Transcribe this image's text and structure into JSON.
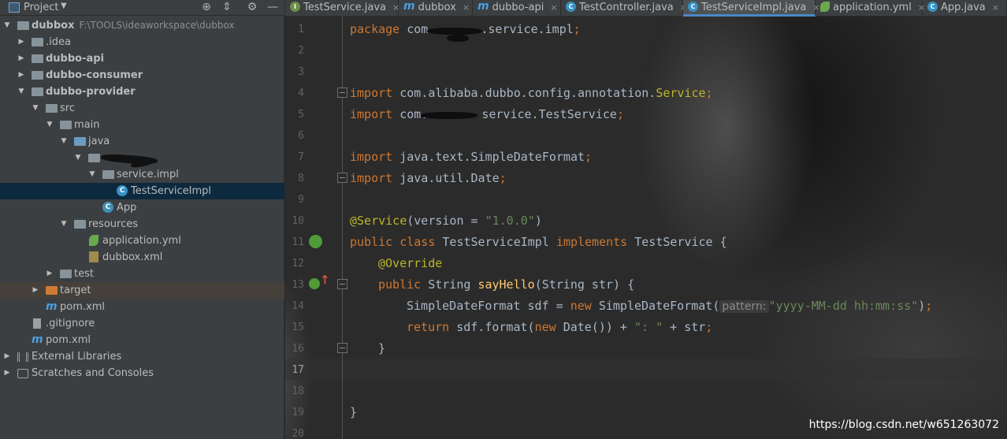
{
  "project_panel": {
    "title": "Project",
    "header_icons": [
      "target-icon",
      "collapse-icon",
      "gear-icon",
      "hide-icon"
    ],
    "tree": [
      {
        "label": "dubbox",
        "path": "F:\\TOOLS\\ideaworkspace\\dubbox",
        "icon": "module-folder-icon",
        "expanded": true
      },
      {
        "label": ".idea",
        "icon": "folder-icon",
        "expanded": false
      },
      {
        "label": "dubbo-api",
        "icon": "module-folder-icon",
        "expanded": false
      },
      {
        "label": "dubbo-consumer",
        "icon": "module-folder-icon",
        "expanded": false
      },
      {
        "label": "dubbo-provider",
        "icon": "module-folder-icon",
        "expanded": true
      },
      {
        "label": "src",
        "icon": "folder-icon",
        "expanded": true
      },
      {
        "label": "main",
        "icon": "folder-icon",
        "expanded": true
      },
      {
        "label": "java",
        "icon": "source-folder-icon",
        "expanded": true
      },
      {
        "label": "",
        "icon": "package-icon",
        "expanded": true
      },
      {
        "label": "service.impl",
        "icon": "package-icon",
        "expanded": true
      },
      {
        "label": "TestServiceImpl",
        "icon": "class-icon",
        "selected": true
      },
      {
        "label": "App",
        "icon": "spring-class-icon"
      },
      {
        "label": "resources",
        "icon": "resources-folder-icon",
        "expanded": true
      },
      {
        "label": "application.yml",
        "icon": "spring-yml-icon"
      },
      {
        "label": "dubbox.xml",
        "icon": "xml-file-icon"
      },
      {
        "label": "test",
        "icon": "folder-icon",
        "expanded": false
      },
      {
        "label": "target",
        "icon": "excluded-folder-icon",
        "expanded": false
      },
      {
        "label": "pom.xml",
        "icon": "maven-icon"
      },
      {
        "label": ".gitignore",
        "icon": "text-file-icon"
      },
      {
        "label": "pom.xml",
        "icon": "maven-icon"
      },
      {
        "label": "External Libraries",
        "icon": "libraries-icon",
        "expanded": false
      },
      {
        "label": "Scratches and Consoles",
        "icon": "scratches-icon",
        "expanded": false
      }
    ]
  },
  "tabs": [
    {
      "label": "TestService.java",
      "icon": "interface-icon"
    },
    {
      "label": "dubbox",
      "icon": "maven-icon"
    },
    {
      "label": "dubbo-api",
      "icon": "maven-icon"
    },
    {
      "label": "TestController.java",
      "icon": "class-icon"
    },
    {
      "label": "TestServiceImpl.java",
      "icon": "class-icon",
      "active": true
    },
    {
      "label": "application.yml",
      "icon": "spring-yml-icon"
    },
    {
      "label": "App.java",
      "icon": "class-icon"
    }
  ],
  "editor": {
    "current_line": 17,
    "line_numbers": [
      "1",
      "2",
      "3",
      "4",
      "5",
      "6",
      "7",
      "8",
      "9",
      "10",
      "11",
      "12",
      "13",
      "14",
      "15",
      "16",
      "17",
      "18",
      "19",
      "20"
    ],
    "code": {
      "l1_kw": "package",
      "l1_a": "com.",
      "l1_b": ".service.impl",
      "l1_semi": ";",
      "l4_kw": "import",
      "l4_a": "com.alibaba.dubbo.config.annotation.",
      "l4_b": "Service",
      "l4_semi": ";",
      "l5_kw": "import",
      "l5_a": "com.",
      "l5_b": "service.TestService",
      "l5_semi": ";",
      "l7_kw": "import",
      "l7_a": "java.text.SimpleDateFormat",
      "l7_semi": ";",
      "l8_kw": "import",
      "l8_a": "java.util.Date",
      "l8_semi": ";",
      "l10_ann": "@Service",
      "l10_a": "(version = ",
      "l10_str": "\"1.0.0\"",
      "l10_b": ")",
      "l11_kw1": "public class",
      "l11_a": "TestServiceImpl",
      "l11_kw2": "implements",
      "l11_b": "TestService {",
      "l12_ann": "@Override",
      "l13_kw": "public",
      "l13_a": "String",
      "l13_fn": "sayHello",
      "l13_b": "(String str) {",
      "l14_a": "SimpleDateFormat sdf = ",
      "l14_kw": "new",
      "l14_b": "SimpleDateFormat(",
      "l14_hint": "pattern:",
      "l14_str": "\"yyyy-MM-dd hh:mm:ss\"",
      "l14_c": ")",
      "l14_semi": ";",
      "l15_kw": "return",
      "l15_a": "sdf.format(",
      "l15_kw2": "new",
      "l15_b": "Date()) + ",
      "l15_str": "\": \"",
      "l15_c": " + str",
      "l15_semi": ";",
      "l16": "}",
      "l19": "}"
    }
  },
  "watermark": "https://blog.csdn.net/w651263072"
}
